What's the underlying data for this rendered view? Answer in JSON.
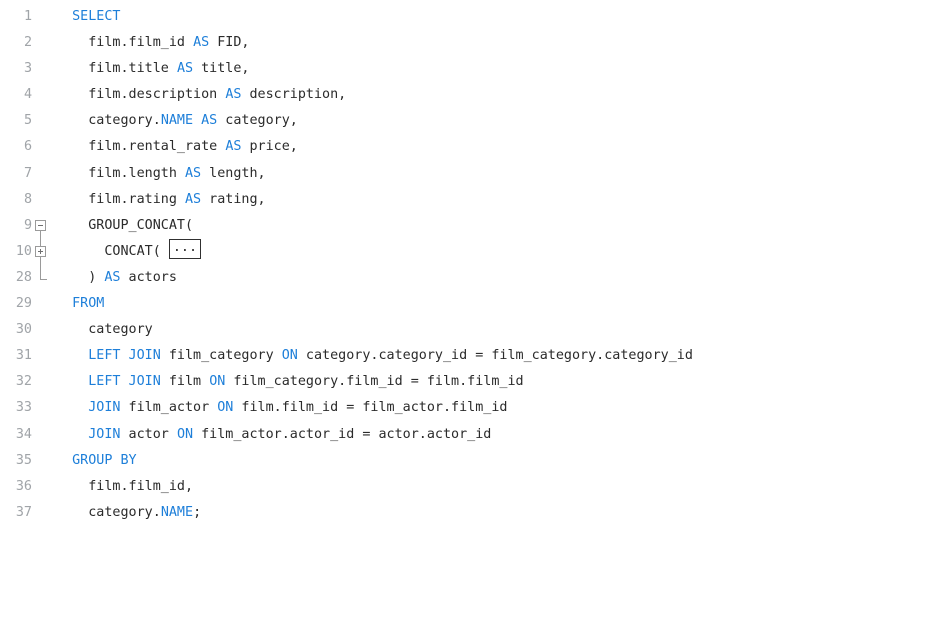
{
  "editor": {
    "lines": [
      {
        "num": "1",
        "indent": "  ",
        "tokens": [
          {
            "t": "SELECT",
            "kw": true
          }
        ]
      },
      {
        "num": "2",
        "indent": "    ",
        "tokens": [
          {
            "t": "film.film_id "
          },
          {
            "t": "AS",
            "kw": true
          },
          {
            "t": " FID,"
          }
        ]
      },
      {
        "num": "3",
        "indent": "    ",
        "tokens": [
          {
            "t": "film.title "
          },
          {
            "t": "AS",
            "kw": true
          },
          {
            "t": " title,"
          }
        ]
      },
      {
        "num": "4",
        "indent": "    ",
        "tokens": [
          {
            "t": "film.description "
          },
          {
            "t": "AS",
            "kw": true
          },
          {
            "t": " description,"
          }
        ]
      },
      {
        "num": "5",
        "indent": "    ",
        "tokens": [
          {
            "t": "category."
          },
          {
            "t": "NAME",
            "kw": true
          },
          {
            "t": " "
          },
          {
            "t": "AS",
            "kw": true
          },
          {
            "t": " category,"
          }
        ]
      },
      {
        "num": "6",
        "indent": "    ",
        "tokens": [
          {
            "t": "film.rental_rate "
          },
          {
            "t": "AS",
            "kw": true
          },
          {
            "t": " price,"
          }
        ]
      },
      {
        "num": "7",
        "indent": "    ",
        "tokens": [
          {
            "t": "film.length "
          },
          {
            "t": "AS",
            "kw": true
          },
          {
            "t": " length,"
          }
        ]
      },
      {
        "num": "8",
        "indent": "    ",
        "tokens": [
          {
            "t": "film.rating "
          },
          {
            "t": "AS",
            "kw": true
          },
          {
            "t": " rating,"
          }
        ]
      },
      {
        "num": "9",
        "indent": "    ",
        "fold": "open",
        "tokens": [
          {
            "t": "GROUP_CONCAT("
          }
        ]
      },
      {
        "num": "10",
        "indent": "      ",
        "fold": "closed",
        "tokens": [
          {
            "t": "CONCAT( "
          }
        ],
        "collapsed": "..."
      },
      {
        "num": "28",
        "indent": "    ",
        "fold": "end",
        "tokens": [
          {
            "t": ") "
          },
          {
            "t": "AS",
            "kw": true
          },
          {
            "t": " actors"
          }
        ]
      },
      {
        "num": "29",
        "indent": "  ",
        "tokens": [
          {
            "t": "FROM",
            "kw": true
          }
        ]
      },
      {
        "num": "30",
        "indent": "    ",
        "tokens": [
          {
            "t": "category"
          }
        ]
      },
      {
        "num": "31",
        "indent": "    ",
        "tokens": [
          {
            "t": "LEFT JOIN",
            "kw": true
          },
          {
            "t": " film_category "
          },
          {
            "t": "ON",
            "kw": true
          },
          {
            "t": " category.category_id = film_category.category_id"
          }
        ]
      },
      {
        "num": "32",
        "indent": "    ",
        "tokens": [
          {
            "t": "LEFT JOIN",
            "kw": true
          },
          {
            "t": " film "
          },
          {
            "t": "ON",
            "kw": true
          },
          {
            "t": " film_category.film_id = film.film_id"
          }
        ]
      },
      {
        "num": "33",
        "indent": "    ",
        "tokens": [
          {
            "t": "JOIN",
            "kw": true
          },
          {
            "t": " film_actor "
          },
          {
            "t": "ON",
            "kw": true
          },
          {
            "t": " film.film_id = film_actor.film_id"
          }
        ]
      },
      {
        "num": "34",
        "indent": "    ",
        "tokens": [
          {
            "t": "JOIN",
            "kw": true
          },
          {
            "t": " actor "
          },
          {
            "t": "ON",
            "kw": true
          },
          {
            "t": " film_actor.actor_id = actor.actor_id"
          }
        ]
      },
      {
        "num": "35",
        "indent": "  ",
        "tokens": [
          {
            "t": "GROUP BY",
            "kw": true
          }
        ]
      },
      {
        "num": "36",
        "indent": "    ",
        "tokens": [
          {
            "t": "film.film_id,"
          }
        ]
      },
      {
        "num": "37",
        "indent": "    ",
        "tokens": [
          {
            "t": "category."
          },
          {
            "t": "NAME",
            "kw": true
          },
          {
            "t": ";"
          }
        ]
      }
    ]
  },
  "colors": {
    "keyword": "#1e7fd9",
    "text": "#2b2b2b",
    "line_number": "#a0a4a8"
  },
  "icons": {
    "fold_open": "fold-collapse-icon",
    "fold_closed": "fold-expand-icon",
    "fold_end": "fold-end-icon"
  }
}
